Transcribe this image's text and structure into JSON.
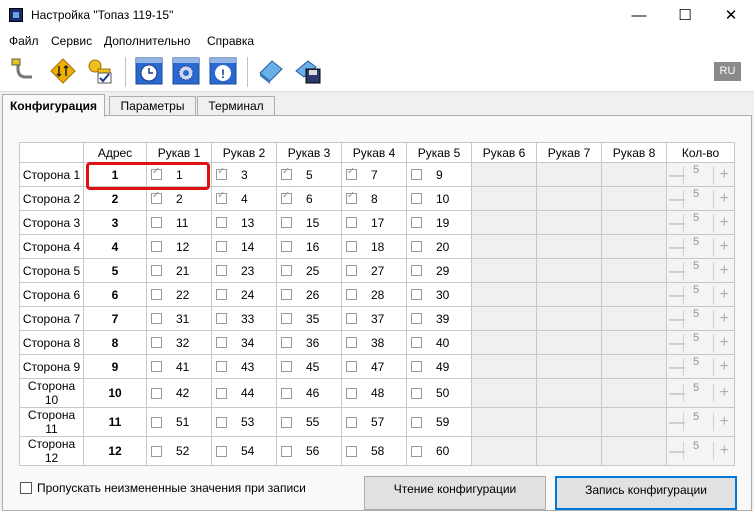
{
  "window": {
    "title": "Настройка \"Топаз 119-15\""
  },
  "menu": [
    "Файл",
    "Сервис",
    "Дополнительно",
    "Справка"
  ],
  "toolbar": {
    "lang": "RU"
  },
  "tabs": [
    "Конфигурация",
    "Параметры",
    "Терминал"
  ],
  "grid": {
    "headers": [
      "Адрес",
      "Рукав 1",
      "Рукав 2",
      "Рукав 3",
      "Рукав 4",
      "Рукав 5",
      "Рукав 6",
      "Рукав 7",
      "Рукав 8",
      "Кол-во"
    ],
    "rows": [
      {
        "label": "Сторона 1",
        "addr": "1",
        "ruk": [
          {
            "n": "1",
            "c": true
          },
          {
            "n": "3",
            "c": true
          },
          {
            "n": "5",
            "c": true
          },
          {
            "n": "7",
            "c": true
          },
          {
            "n": "9",
            "c": false
          }
        ],
        "kol": "5"
      },
      {
        "label": "Сторона 2",
        "addr": "2",
        "ruk": [
          {
            "n": "2",
            "c": true
          },
          {
            "n": "4",
            "c": true
          },
          {
            "n": "6",
            "c": true
          },
          {
            "n": "8",
            "c": true
          },
          {
            "n": "10",
            "c": false
          }
        ],
        "kol": "5"
      },
      {
        "label": "Сторона 3",
        "addr": "3",
        "ruk": [
          {
            "n": "11",
            "c": false
          },
          {
            "n": "13",
            "c": false
          },
          {
            "n": "15",
            "c": false
          },
          {
            "n": "17",
            "c": false
          },
          {
            "n": "19",
            "c": false
          }
        ],
        "kol": "5"
      },
      {
        "label": "Сторона 4",
        "addr": "4",
        "ruk": [
          {
            "n": "12",
            "c": false
          },
          {
            "n": "14",
            "c": false
          },
          {
            "n": "16",
            "c": false
          },
          {
            "n": "18",
            "c": false
          },
          {
            "n": "20",
            "c": false
          }
        ],
        "kol": "5"
      },
      {
        "label": "Сторона 5",
        "addr": "5",
        "ruk": [
          {
            "n": "21",
            "c": false
          },
          {
            "n": "23",
            "c": false
          },
          {
            "n": "25",
            "c": false
          },
          {
            "n": "27",
            "c": false
          },
          {
            "n": "29",
            "c": false
          }
        ],
        "kol": "5"
      },
      {
        "label": "Сторона 6",
        "addr": "6",
        "ruk": [
          {
            "n": "22",
            "c": false
          },
          {
            "n": "24",
            "c": false
          },
          {
            "n": "26",
            "c": false
          },
          {
            "n": "28",
            "c": false
          },
          {
            "n": "30",
            "c": false
          }
        ],
        "kol": "5"
      },
      {
        "label": "Сторона 7",
        "addr": "7",
        "ruk": [
          {
            "n": "31",
            "c": false
          },
          {
            "n": "33",
            "c": false
          },
          {
            "n": "35",
            "c": false
          },
          {
            "n": "37",
            "c": false
          },
          {
            "n": "39",
            "c": false
          }
        ],
        "kol": "5"
      },
      {
        "label": "Сторона 8",
        "addr": "8",
        "ruk": [
          {
            "n": "32",
            "c": false
          },
          {
            "n": "34",
            "c": false
          },
          {
            "n": "36",
            "c": false
          },
          {
            "n": "38",
            "c": false
          },
          {
            "n": "40",
            "c": false
          }
        ],
        "kol": "5"
      },
      {
        "label": "Сторона 9",
        "addr": "9",
        "ruk": [
          {
            "n": "41",
            "c": false
          },
          {
            "n": "43",
            "c": false
          },
          {
            "n": "45",
            "c": false
          },
          {
            "n": "47",
            "c": false
          },
          {
            "n": "49",
            "c": false
          }
        ],
        "kol": "5"
      },
      {
        "label": "Сторона 10",
        "addr": "10",
        "ruk": [
          {
            "n": "42",
            "c": false
          },
          {
            "n": "44",
            "c": false
          },
          {
            "n": "46",
            "c": false
          },
          {
            "n": "48",
            "c": false
          },
          {
            "n": "50",
            "c": false
          }
        ],
        "kol": "5"
      },
      {
        "label": "Сторона 11",
        "addr": "11",
        "ruk": [
          {
            "n": "51",
            "c": false
          },
          {
            "n": "53",
            "c": false
          },
          {
            "n": "55",
            "c": false
          },
          {
            "n": "57",
            "c": false
          },
          {
            "n": "59",
            "c": false
          }
        ],
        "kol": "5"
      },
      {
        "label": "Сторона 12",
        "addr": "12",
        "ruk": [
          {
            "n": "52",
            "c": false
          },
          {
            "n": "54",
            "c": false
          },
          {
            "n": "56",
            "c": false
          },
          {
            "n": "58",
            "c": false
          },
          {
            "n": "60",
            "c": false
          }
        ],
        "kol": "5"
      }
    ]
  },
  "bottom": {
    "checkbox_label": "Пропускать неизмененные значения при записи",
    "read_button": "Чтение конфигурации",
    "write_button": "Запись конфигурации"
  },
  "colors": {
    "highlight": "#e01010",
    "accent": "#0078d7"
  }
}
